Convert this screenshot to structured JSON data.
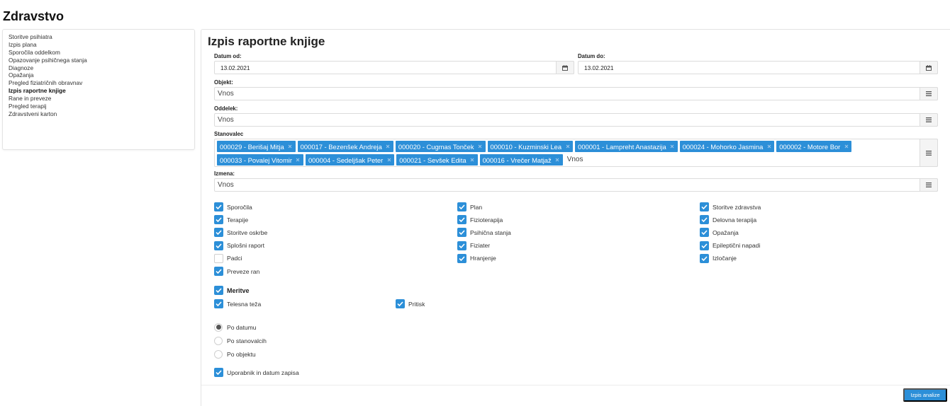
{
  "app": {
    "title": "Zdravstvo"
  },
  "sidebar": {
    "items": [
      {
        "label": "Storitve psihiatra"
      },
      {
        "label": "Izpis plana"
      },
      {
        "label": "Sporočila oddelkom"
      },
      {
        "label": "Opazovanje psihičnega stanja"
      },
      {
        "label": "Diagnoze"
      },
      {
        "label": "Opažanja"
      },
      {
        "label": "Pregled fiziatričnih obravnav"
      },
      {
        "label": "Izpis raportne knjige",
        "active": true
      },
      {
        "label": "Rane in preveze"
      },
      {
        "label": "Pregled terapij"
      },
      {
        "label": "Zdravstveni karton"
      }
    ]
  },
  "form": {
    "title": "Izpis raportne knjige",
    "date_from": {
      "label": "Datum od:",
      "value": "13.02.2021",
      "icon": "calendar-icon"
    },
    "date_to": {
      "label": "Datum do:",
      "value": "13.02.2021",
      "icon": "calendar-icon"
    },
    "objekt": {
      "label": "Objekt:",
      "placeholder": "Vnos",
      "icon": "list-icon"
    },
    "oddelek": {
      "label": "Oddelek:",
      "placeholder": "Vnos",
      "icon": "list-icon"
    },
    "stanovalec": {
      "label": "Stanovalec",
      "placeholder": "Vnos",
      "icon": "list-icon",
      "tags": [
        "000029 - Berišaj Mitja",
        "000017 - Bezenšek Andreja",
        "000020 - Cugmas Tonček",
        "000010 - Kuzminski Lea",
        "000001 - Lampreht Anastazija",
        "000024 - Mohorko Jasmina",
        "000002 - Motore Bor",
        "000033 - Povalej Vitomir",
        "000004 - Sedeljšak Peter",
        "000021 - Sevšek Edita",
        "000016 - Vrečer Matjaž"
      ]
    },
    "izmena": {
      "label": "Izmena:",
      "placeholder": "Vnos",
      "icon": "list-icon"
    },
    "options": [
      {
        "label": "Sporočila",
        "checked": true
      },
      {
        "label": "Plan",
        "checked": true
      },
      {
        "label": "Storitve zdravstva",
        "checked": true
      },
      {
        "label": "Terapije",
        "checked": true
      },
      {
        "label": "Fizioterapija",
        "checked": true
      },
      {
        "label": "Delovna terapija",
        "checked": true
      },
      {
        "label": "Storitve oskrbe",
        "checked": true
      },
      {
        "label": "Psihična stanja",
        "checked": true
      },
      {
        "label": "Opažanja",
        "checked": true
      },
      {
        "label": "Splošni raport",
        "checked": true
      },
      {
        "label": "Fiziater",
        "checked": true
      },
      {
        "label": "Epileptični napadi",
        "checked": true
      },
      {
        "label": "Padci",
        "checked": false
      },
      {
        "label": "Hranjenje",
        "checked": true
      },
      {
        "label": "Izločanje",
        "checked": true
      },
      {
        "label": "Preveze ran",
        "checked": true
      }
    ],
    "meritve": {
      "label": "Meritve",
      "checked": true,
      "items": [
        {
          "label": "Telesna teža",
          "checked": true
        },
        {
          "label": "Pritisk",
          "checked": true
        }
      ]
    },
    "sort": [
      {
        "label": "Po datumu",
        "selected": true
      },
      {
        "label": "Po stanovalcih",
        "selected": false
      },
      {
        "label": "Po objektu",
        "selected": false
      }
    ],
    "user_date": {
      "label": "Uporabnik in datum zapisa",
      "checked": true
    },
    "submit_label": "Izpis analize"
  },
  "colors": {
    "accent": "#2c8fd8",
    "border": "#dcdcdc"
  }
}
